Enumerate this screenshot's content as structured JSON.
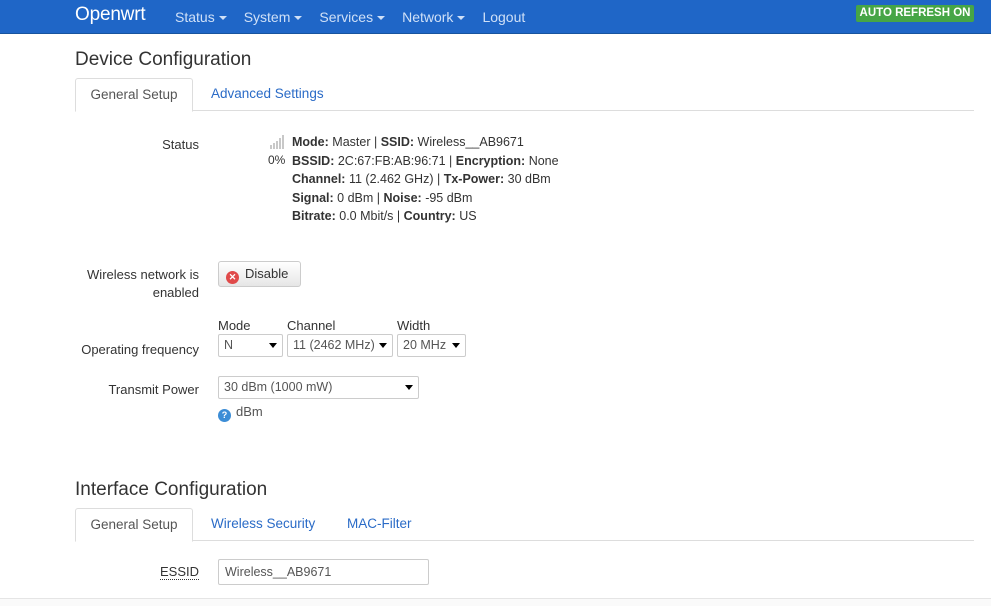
{
  "nav": {
    "brand": "Openwrt",
    "items": [
      "Status",
      "System",
      "Services",
      "Network"
    ],
    "logout": "Logout",
    "auto_refresh": "AUTO REFRESH ON"
  },
  "device": {
    "title": "Device Configuration",
    "tabs": [
      "General Setup",
      "Advanced Settings"
    ],
    "status_label": "Status",
    "signal_percent": "0%",
    "status": {
      "mode_key": "Mode:",
      "mode_val": "Master",
      "ssid_key": "SSID:",
      "ssid_val": "Wireless__AB9671",
      "bssid_key": "BSSID:",
      "bssid_val": "2C:67:FB:AB:96:71",
      "enc_key": "Encryption:",
      "enc_val": "None",
      "channel_key": "Channel:",
      "channel_val": "11 (2.462 GHz)",
      "txpower_key": "Tx-Power:",
      "txpower_val": "30 dBm",
      "signal_key": "Signal:",
      "signal_val": "0 dBm",
      "noise_key": "Noise:",
      "noise_val": "-95 dBm",
      "bitrate_key": "Bitrate:",
      "bitrate_val": "0.0 Mbit/s",
      "country_key": "Country:",
      "country_val": "US"
    },
    "enabled_label_1": "Wireless network is",
    "enabled_label_2": "enabled",
    "disable_button": "Disable",
    "freq_label": "Operating frequency",
    "mode_label": "Mode",
    "channel_label": "Channel",
    "width_label": "Width",
    "mode_value": "N",
    "channel_value": "11 (2462 MHz)",
    "width_value": "20 MHz",
    "txpower_label": "Transmit Power",
    "txpower_value": "30 dBm (1000 mW)",
    "txpower_help": "dBm"
  },
  "interface": {
    "title": "Interface Configuration",
    "tabs": [
      "General Setup",
      "Wireless Security",
      "MAC-Filter"
    ],
    "essid_label": "ESSID",
    "essid_value": "Wireless__AB9671"
  },
  "colors": {
    "navbar": "#1f66c7",
    "link": "#2a6bc7",
    "badge": "#46a546"
  }
}
